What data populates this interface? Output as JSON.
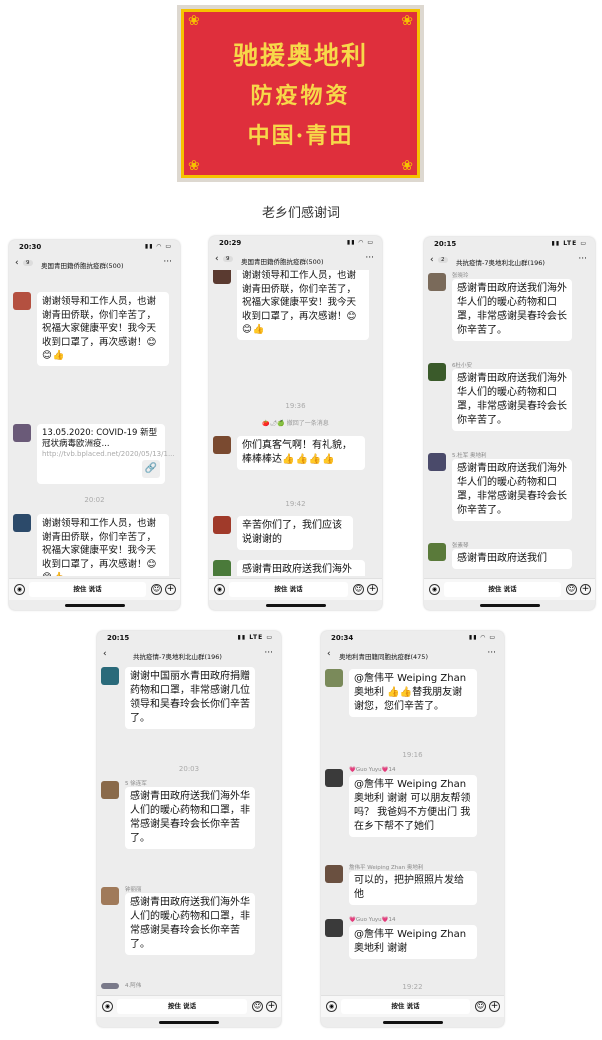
{
  "banner": {
    "line1": "驰援奥地利",
    "line2": "防疫物资",
    "line3": "中国·青田",
    "colors": {
      "background": "#df2f3c",
      "text": "#f7d84a",
      "border": "#f6c200"
    }
  },
  "caption": "老乡们感谢词",
  "input_bar": {
    "hold_to_talk": "按住 说话"
  },
  "phones": [
    {
      "status_time": "20:30",
      "unread": "9",
      "title": "奥国青田籍侨胞抗疫群(500)",
      "messages": [
        {
          "text": "谢谢领导和工作人员，也谢谢青田侨联，你们辛苦了，祝福大家健康平安！我今天收到口罩了，再次感谢！",
          "emoji": "😊😊👍"
        },
        {
          "link_title": "13.05.2020: COVID-19 新型冠状病毒欧洲疫...",
          "link_url": "http://tvb.bplaced.net/2020/05/13/1..."
        },
        {
          "time": "20:02"
        },
        {
          "text": "谢谢领导和工作人员，也谢谢青田侨联，你们辛苦了，祝福大家健康平安！我今天收到口罩了，再次感谢！",
          "emoji": "😊😊👍"
        }
      ]
    },
    {
      "status_time": "20:29",
      "unread": "9",
      "title": "奥国青田籍侨胞抗疫群(500)",
      "messages": [
        {
          "text": "谢谢领导和工作人员，也谢谢青田侨联，你们辛苦了，祝福大家健康平安！我今天收到口罩了，再次感谢！",
          "emoji": "😊😊👍"
        },
        {
          "time": "19:36"
        },
        {
          "system": "🍅🌶🍏 撤回了一条消息"
        },
        {
          "text": "你们真客气啊！有礼貌，棒棒棒达",
          "emoji": "👍👍👍👍"
        },
        {
          "time": "19:42"
        },
        {
          "text": "辛苦你们了，我们应该说谢谢的"
        },
        {
          "text": "感谢青田政府送我们海外华人们的暖心包，温暖人心！让我"
        }
      ]
    },
    {
      "status_time": "20:15",
      "unread": "2",
      "title": "共抗疫情-7奥地利北山群(196)",
      "messages": [
        {
          "sender": "张晓玲",
          "text": "感谢青田政府送我们海外华人们的暖心药物和口罩，非常感谢吴春玲会长你辛苦了。"
        },
        {
          "sender": "6杜小安",
          "text": "感谢青田政府送我们海外华人们的暖心药物和口罩，非常感谢吴春玲会长你辛苦了。"
        },
        {
          "sender": "5.杜军 奥地利",
          "text": "感谢青田政府送我们海外华人们的暖心药物和口罩，非常感谢吴春玲会长你辛苦了。"
        },
        {
          "sender": "张素琴",
          "text": "感谢青田政府送我们"
        }
      ]
    },
    {
      "status_time": "20:15",
      "unread": "",
      "title": "共抗疫情-7奥地利北山群(196)",
      "messages": [
        {
          "text": "谢谢中国丽水青田政府捐赠药物和口罩，非常感谢几位领导和吴春玲会长你们辛苦了。"
        },
        {
          "time": "20:03"
        },
        {
          "sender": "5 徐连军",
          "text": "感谢青田政府送我们海外华人们的暖心药物和口罩，非常感谢吴春玲会长你辛苦了。"
        },
        {
          "sender": "钟丽丽",
          "text": "感谢青田政府送我们海外华人们的暖心药物和口罩，非常感谢吴春玲会长你辛苦了。"
        },
        {
          "sender": "4.阿伟"
        }
      ]
    },
    {
      "status_time": "20:34",
      "unread": "",
      "title": "奥地利青田籍同胞抗疫群(475)",
      "messages": [
        {
          "text": "@詹伟平 Weiping Zhan 奥地利 👍👍替我朋友谢谢您，您们辛苦了。"
        },
        {
          "time": "19:16"
        },
        {
          "sender": "💗Guo Yuyu💗14",
          "text": "@詹伟平 Weiping Zhan 奥地利 谢谢 可以朋友帮领吗？ 我爸妈不方便出门 我在乡下帮不了她们"
        },
        {
          "sender": "詹伟平 Weiping Zhan 奥地利",
          "text": "可以的，把护照照片发给他"
        },
        {
          "sender": "💗Guo Yuyu💗14",
          "text": "@詹伟平 Weiping Zhan 奥地利 谢谢"
        },
        {
          "time": "19:22"
        }
      ]
    }
  ]
}
